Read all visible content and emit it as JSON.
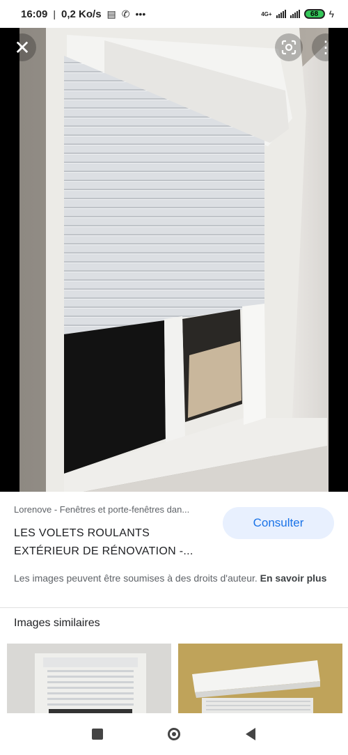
{
  "status_bar": {
    "time": "16:09",
    "speed": "0,2 Ko/s",
    "network_label": "4G+",
    "battery": "68",
    "icons": [
      "message-icon",
      "whatsapp-icon",
      "more-dots-icon",
      "signal-icon",
      "battery-icon",
      "charging-icon"
    ]
  },
  "viewer": {
    "close_glyph": "✕",
    "more_glyph": "⋮",
    "icons": [
      "close-icon",
      "google-lens-icon",
      "more-vert-icon"
    ]
  },
  "info": {
    "source": "Lorenove - Fenêtres et porte-fenêtres dan...",
    "title_line1": "LES VOLETS ROULANTS",
    "title_line2": "EXTÉRIEUR DE RÉNOVATION -...",
    "consult_label": "Consulter",
    "copyright": "Les images peuvent être soumises à des droits d'auteur.",
    "learn_more": "En savoir plus"
  },
  "similar": {
    "title": "Images similaires"
  },
  "colors": {
    "accent": "#1a73e8",
    "button_bg": "#e8f0fe",
    "text_secondary": "#5f6368"
  }
}
